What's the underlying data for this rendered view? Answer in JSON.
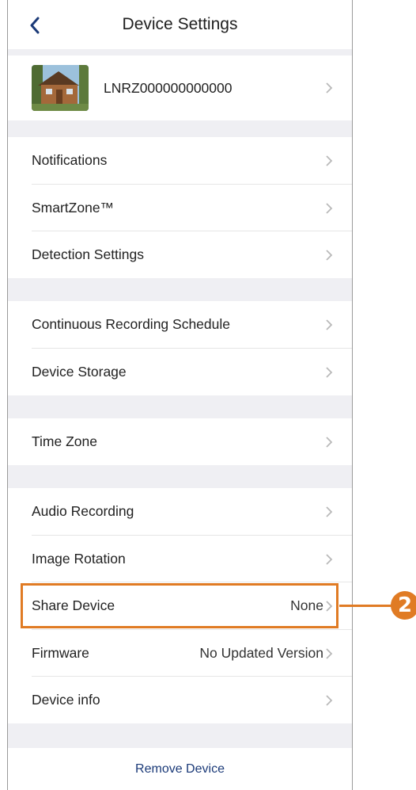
{
  "header": {
    "title": "Device Settings"
  },
  "device": {
    "name": "LNRZ000000000000"
  },
  "groups": [
    {
      "items": [
        {
          "label": "Notifications"
        },
        {
          "label": "SmartZone™"
        },
        {
          "label": "Detection Settings"
        }
      ]
    },
    {
      "items": [
        {
          "label": "Continuous Recording Schedule"
        },
        {
          "label": "Device Storage"
        }
      ]
    },
    {
      "items": [
        {
          "label": "Time Zone"
        }
      ]
    },
    {
      "items": [
        {
          "label": "Audio Recording"
        },
        {
          "label": "Image Rotation"
        },
        {
          "label": "Share Device",
          "value": "None"
        },
        {
          "label": "Firmware",
          "value": "No Updated Version"
        },
        {
          "label": "Device info"
        }
      ]
    }
  ],
  "footer": {
    "remove_label": "Remove Device"
  },
  "callout": {
    "number": "2",
    "color": "#e07b24"
  },
  "colors": {
    "accent": "#1b3a78",
    "section_gap": "#efeff3"
  }
}
